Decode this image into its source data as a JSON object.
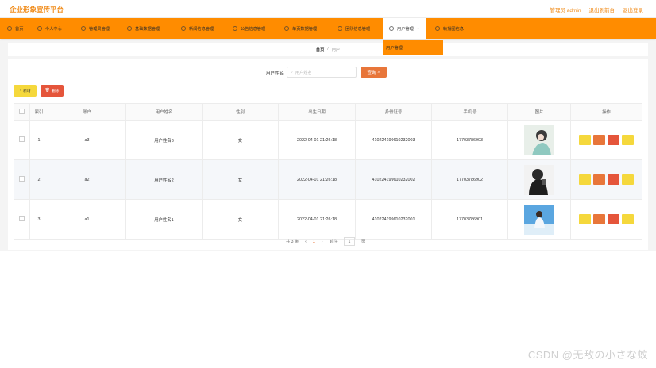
{
  "app": {
    "title": "企业形象宣传平台"
  },
  "top_links": [
    "管理员 admin",
    "退出到前台",
    "退出登录"
  ],
  "nav": [
    {
      "label": "首页"
    },
    {
      "label": "个人中心"
    },
    {
      "label": "管理员管理"
    },
    {
      "label": "基础数据管理"
    },
    {
      "label": "新闻信息管理"
    },
    {
      "label": "公告信息管理"
    },
    {
      "label": "单页数据管理"
    },
    {
      "label": "团队信息管理"
    },
    {
      "label": "用户管理",
      "active": true
    },
    {
      "label": "轮播图信息"
    }
  ],
  "dropdown": {
    "item": "用户管理"
  },
  "breadcrumb": {
    "home": "首页",
    "sep": "/",
    "current": "用户"
  },
  "search": {
    "label": "用户姓名",
    "placeholder": "用户姓名",
    "button": "查询"
  },
  "actions": {
    "add": "新增",
    "delete": "删除"
  },
  "table": {
    "headers": [
      "",
      "索引",
      "账户",
      "用户姓名",
      "性别",
      "出生日期",
      "身份证号",
      "手机号",
      "图片",
      "操作"
    ],
    "rows": [
      {
        "index": "1",
        "account": "a3",
        "name": "用户姓名3",
        "gender": "女",
        "birth": "2022-04-01 21:26:18",
        "id_card": "410224199610232003",
        "phone": "17703786903"
      },
      {
        "index": "2",
        "account": "a2",
        "name": "用户姓名2",
        "gender": "女",
        "birth": "2022-04-01 21:26:18",
        "id_card": "410224199610232002",
        "phone": "17703786902"
      },
      {
        "index": "3",
        "account": "a1",
        "name": "用户姓名1",
        "gender": "女",
        "birth": "2022-04-01 21:26:18",
        "id_card": "410224199610232001",
        "phone": "17703786901"
      }
    ]
  },
  "pagination": {
    "total": "共 3 条",
    "page": "1",
    "goto": "前往",
    "page_input": "1",
    "unit": "页"
  },
  "watermark": "CSDN @无敌の小さな蚊",
  "colors": {
    "accent": "#ff8c00",
    "search_button": "#e8763a",
    "add": "#f5d83c",
    "delete": "#e5553b"
  }
}
